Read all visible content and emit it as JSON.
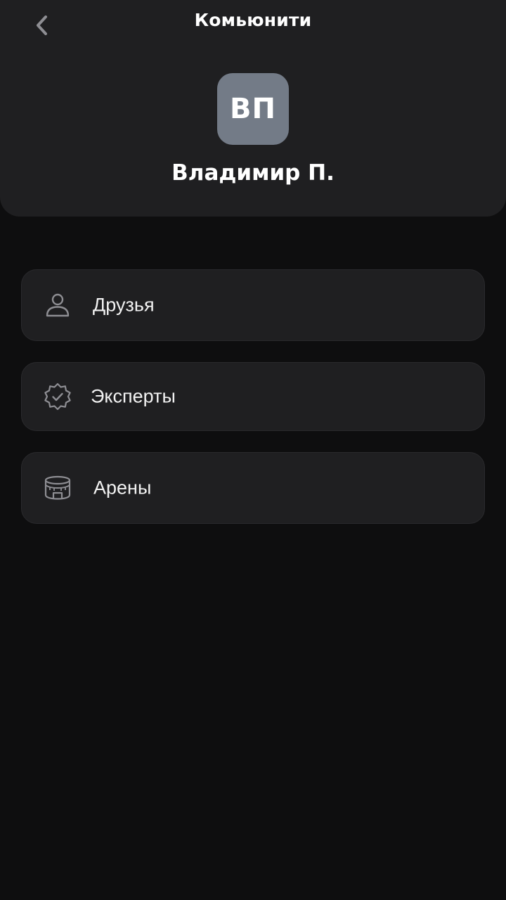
{
  "header": {
    "title": "Комьюнити",
    "back_icon": "chevron-left-icon"
  },
  "profile": {
    "initials": "ВП",
    "name": "Владимир П.",
    "avatar_color": "#737b87"
  },
  "menu": {
    "items": [
      {
        "label": "Друзья",
        "icon": "person-icon"
      },
      {
        "label": "Эксперты",
        "icon": "verified-badge-icon"
      },
      {
        "label": "Арены",
        "icon": "stadium-icon"
      }
    ]
  },
  "colors": {
    "background": "#0e0e0f",
    "card": "#1f1f21",
    "icon": "#8e8e93",
    "text": "#ffffff"
  }
}
